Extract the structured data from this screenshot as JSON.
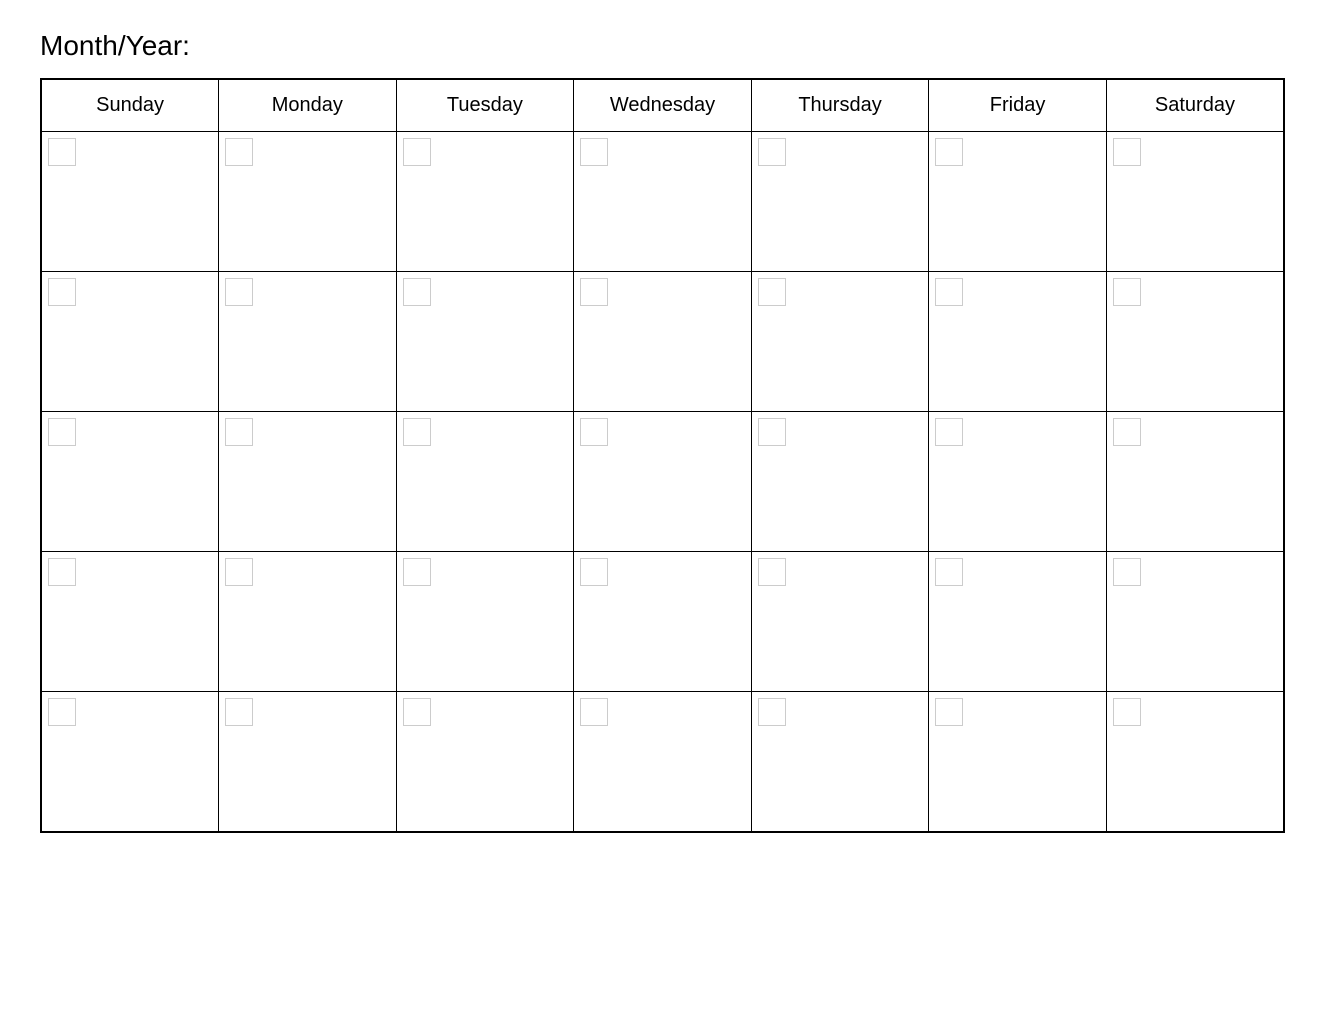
{
  "header": {
    "title": "Month/Year:"
  },
  "calendar": {
    "days": [
      "Sunday",
      "Monday",
      "Tuesday",
      "Wednesday",
      "Thursday",
      "Friday",
      "Saturday"
    ],
    "rows": 5
  }
}
